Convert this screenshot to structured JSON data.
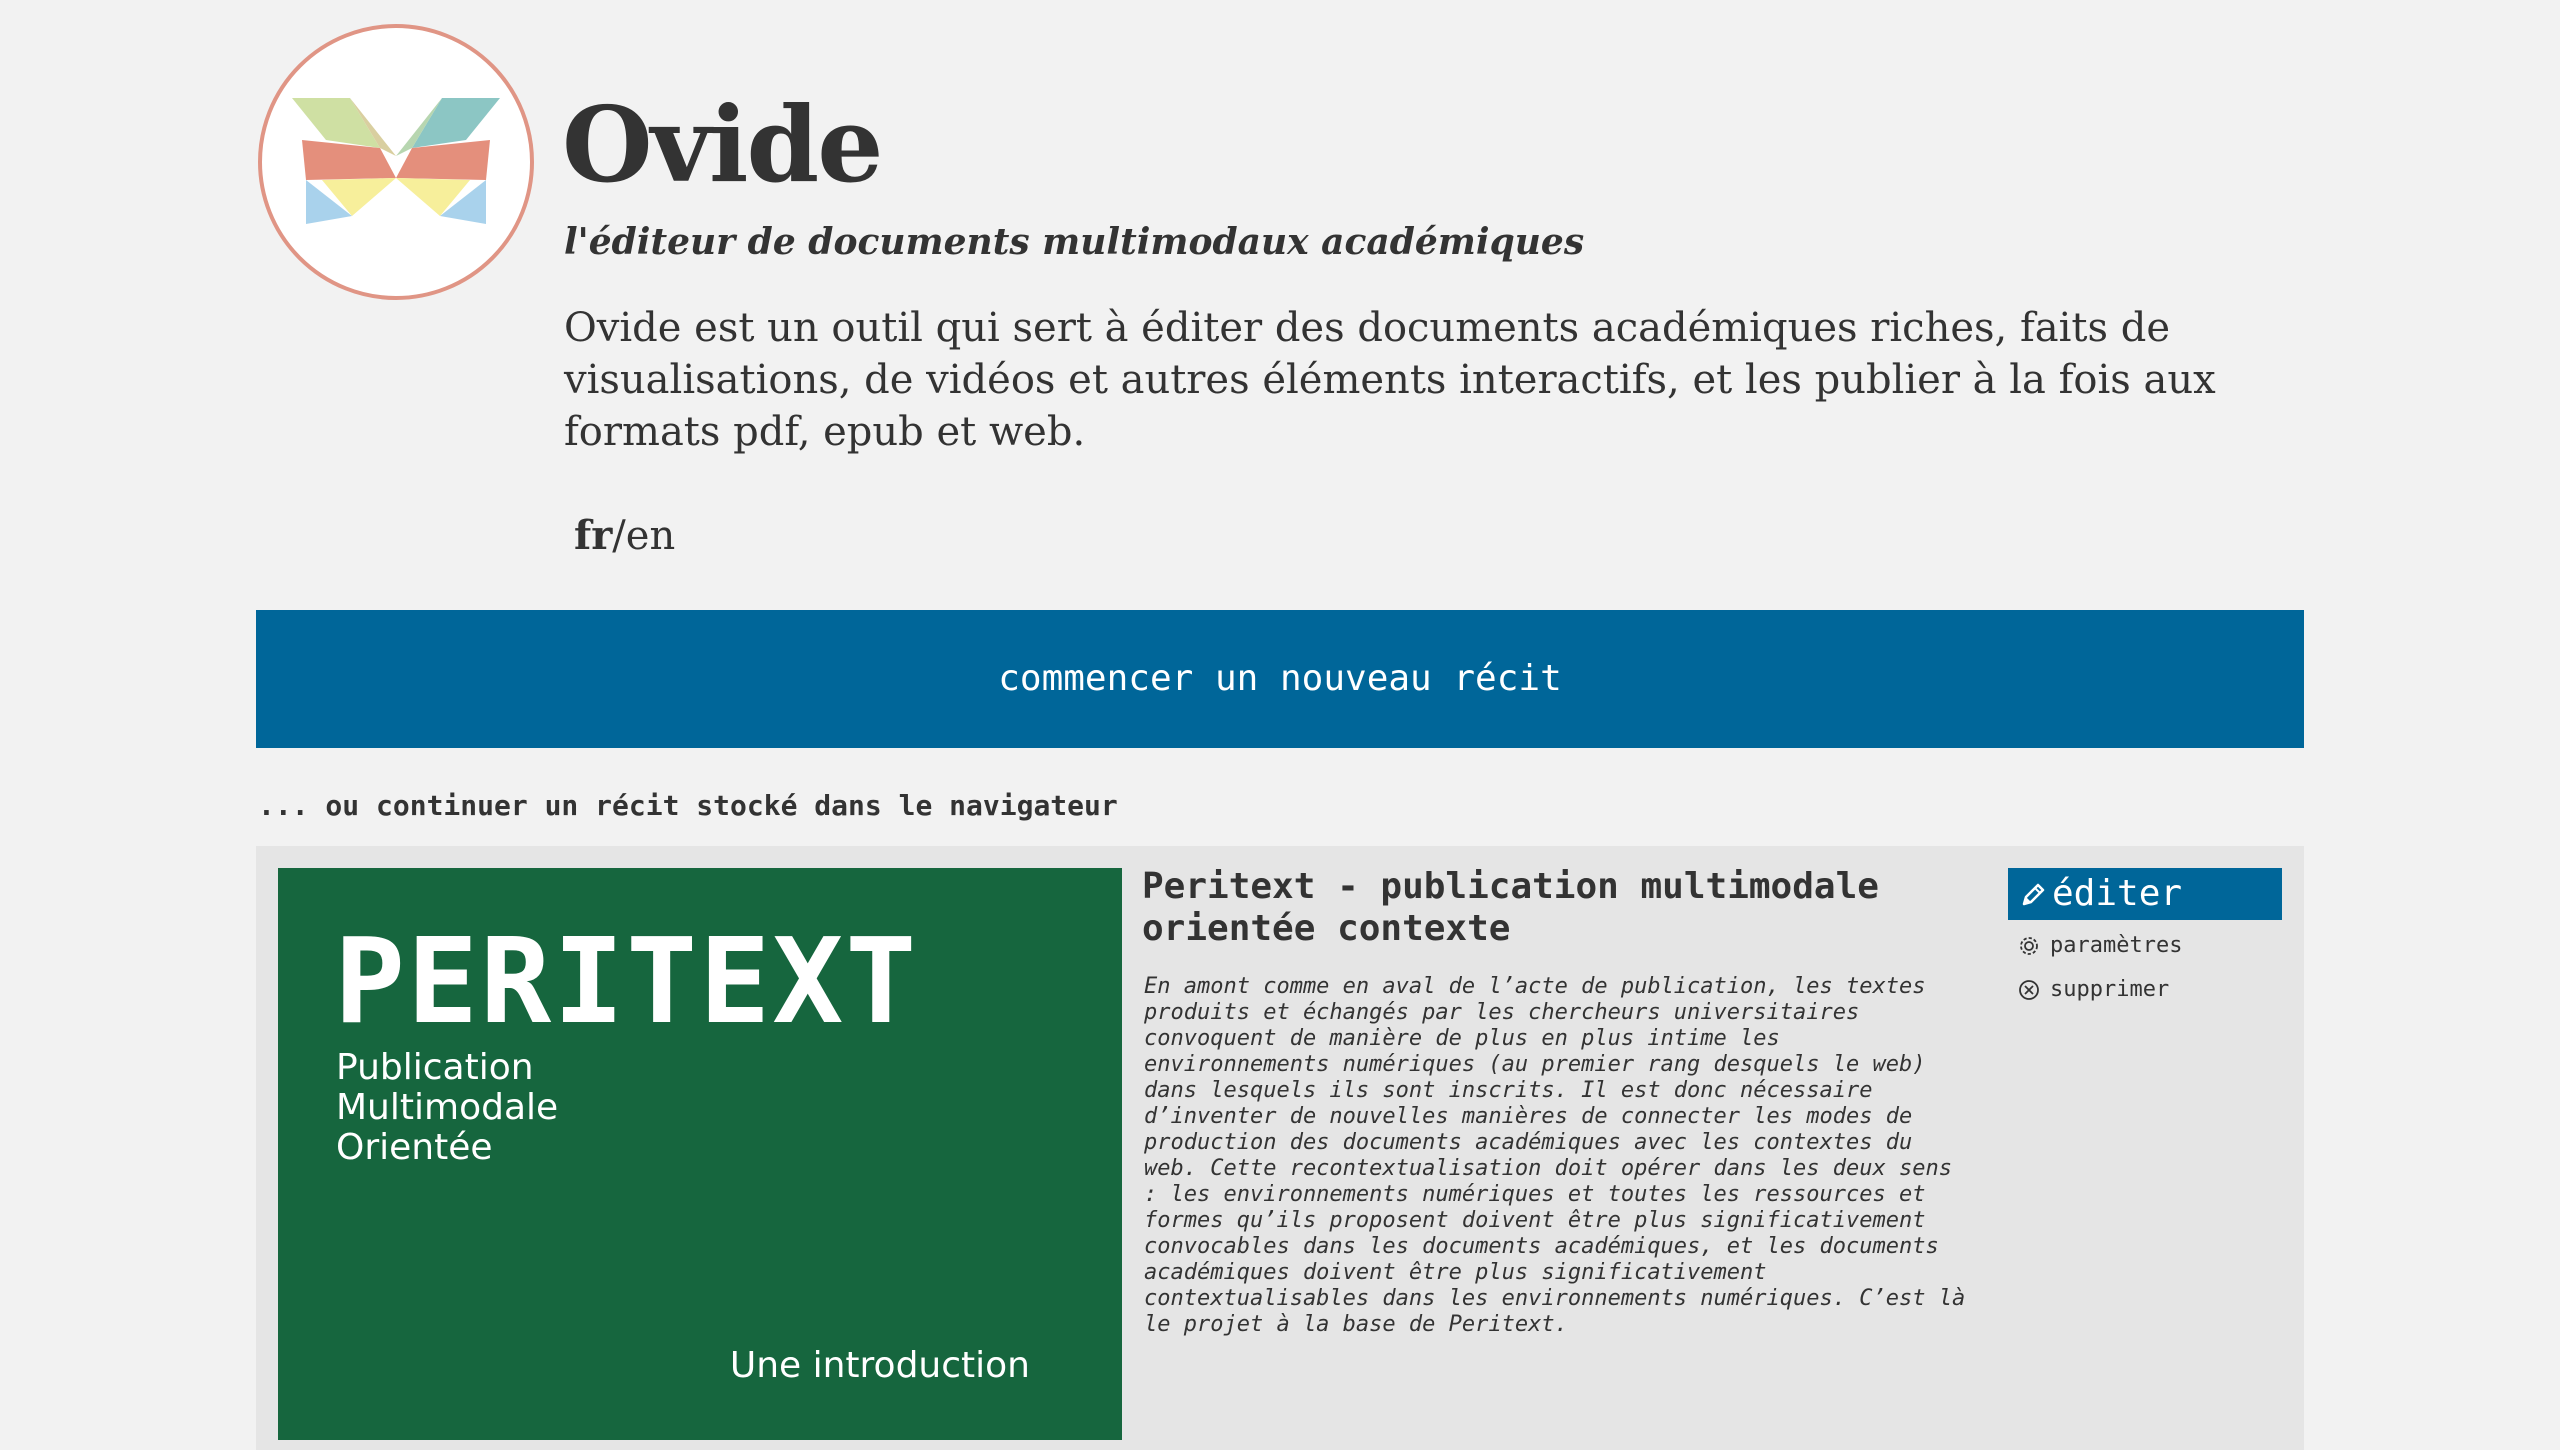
{
  "header": {
    "title": "Ovide",
    "tagline": "l'éditeur de documents multimodaux académiques",
    "description": "Ovide est un outil qui sert à éditer des documents académiques riches, faits de visualisations, de vidéos et autres éléments interactifs, et les publier à la fois aux formats pdf, epub et web.",
    "languages": {
      "active": "fr",
      "separator": "/",
      "other": "en"
    }
  },
  "main": {
    "start_button_label": "commencer un nouveau récit",
    "continue_label": "... ou continuer un récit stocké dans le navigateur",
    "stories": [
      {
        "cover": {
          "brand": "PERITEXT",
          "subtitle_lines": [
            "Publication",
            "Multimodale",
            "Orientée"
          ],
          "intro": "Une introduction"
        },
        "title": "Peritext - publication multimodale orientée contexte",
        "abstract": "En amont comme en aval de l’acte de publication, les textes produits et échangés par les chercheurs universitaires convoquent de manière de plus en plus intime les environnements numériques (au premier rang desquels le web) dans lesquels ils sont inscrits. Il est donc nécessaire d’inventer de nouvelles manières de connecter les modes de production des documents académiques avec les contextes du web. Cette recontextualisation doit opérer dans les deux sens : les environnements numériques et toutes les ressources et formes qu’ils proposent doivent être plus significativement convocables dans les documents académiques, et les documents académiques doivent être plus significativement contextualisables dans les environnements numériques. C’est là le projet à la base de Peritext.",
        "actions": {
          "edit_label": "éditer",
          "settings_label": "paramètres",
          "delete_label": "supprimer"
        }
      }
    ]
  },
  "icons": {
    "logo": "butterfly-logo",
    "edit": "pencil-icon",
    "settings": "gear-icon",
    "delete": "circle-x-icon"
  },
  "colors": {
    "background": "#f2f2f2",
    "accent": "#006699",
    "logo_ring": "#e09585",
    "cover_green": "#16663e",
    "text": "#333333"
  }
}
